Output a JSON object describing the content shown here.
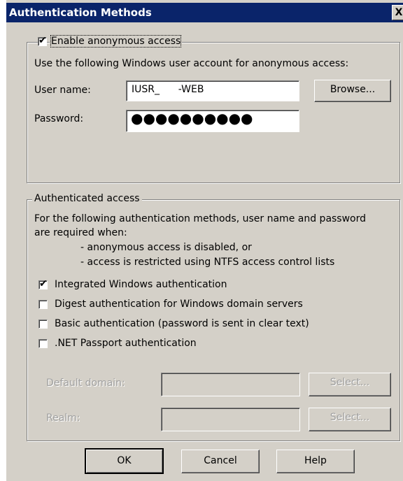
{
  "window": {
    "title": "Authentication Methods",
    "close_label": "X"
  },
  "anonymous": {
    "checkbox_label": "Enable anonymous access",
    "checked": true,
    "description": "Use the following Windows user account for anonymous access:",
    "user_name_label": "User name:",
    "user_name_value": "IUSR_      -WEB",
    "password_label": "Password:",
    "password_value": "●●●●●●●●●●",
    "browse_label": "Browse..."
  },
  "authenticated": {
    "legend": "Authenticated access",
    "description_line1": "For the following authentication methods, user name and password",
    "description_line2": "are required when:",
    "bullet1": "- anonymous access is disabled, or",
    "bullet2": "- access is restricted using NTFS access control lists",
    "options": [
      {
        "label": "Integrated Windows authentication",
        "checked": true
      },
      {
        "label": "Digest authentication for Windows domain servers",
        "checked": false
      },
      {
        "label": "Basic authentication (password is sent in clear text)",
        "checked": false
      },
      {
        "label": ".NET Passport authentication",
        "checked": false
      }
    ],
    "default_domain_label": "Default domain:",
    "realm_label": "Realm:",
    "select_label": "Select..."
  },
  "buttons": {
    "ok": "OK",
    "cancel": "Cancel",
    "help": "Help"
  },
  "check_glyph": "✔"
}
